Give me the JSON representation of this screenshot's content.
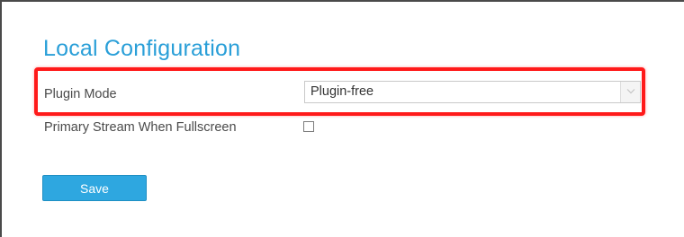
{
  "page": {
    "title": "Local Configuration"
  },
  "settings": {
    "plugin_mode": {
      "label": "Plugin Mode",
      "value": "Plugin-free"
    },
    "primary_stream": {
      "label": "Primary Stream When Fullscreen",
      "checked": false
    }
  },
  "actions": {
    "save_label": "Save"
  },
  "colors": {
    "accent": "#2ea7e0",
    "title": "#2a9fd8",
    "highlight": "#ff1a1a"
  },
  "icons": {
    "dropdown": "chevron-down-icon"
  }
}
